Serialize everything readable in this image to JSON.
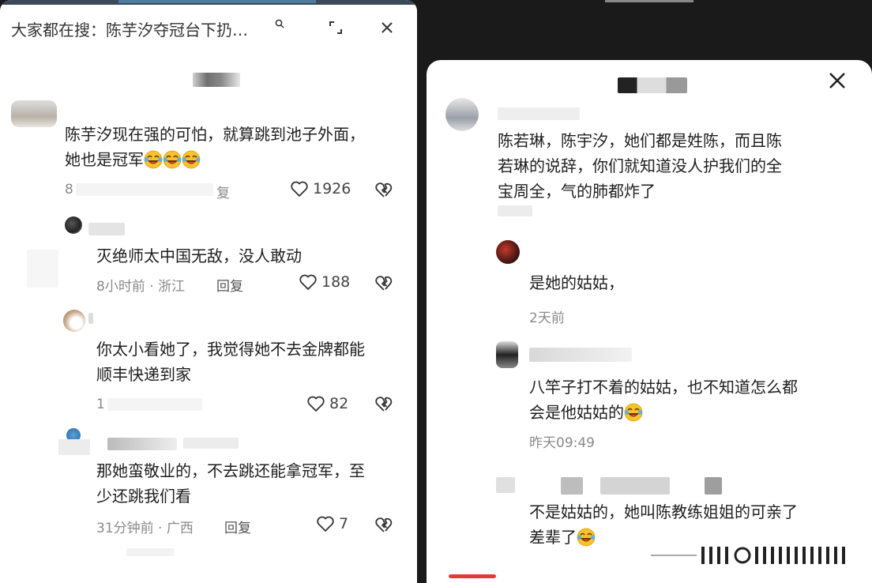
{
  "left_panel": {
    "search": {
      "prefix": "大家都在搜：",
      "query": "陈芋汐夺冠台下扔…"
    },
    "comments": [
      {
        "text_line1": "陈芋汐现在强的可怕，就算跳到池子外面，",
        "text_line2": "她也是冠军",
        "meta_partial": "8",
        "reply_partial": "复",
        "likes": "1926"
      },
      {
        "text": "灭绝师太中国无敌，没人敢动",
        "time": "8小时前",
        "location": "浙江",
        "reply": "回复",
        "likes": "188"
      },
      {
        "text_line1": "你太小看她了，我觉得她不去金牌都能",
        "text_line2": "顺丰快递到家",
        "meta_partial": "1",
        "likes": "82"
      },
      {
        "text_line1": "那她蛮敬业的，不去跳还能拿冠军，至",
        "text_line2": "少还跳我们看",
        "time": "31分钟前",
        "location": "广西",
        "reply": "回复",
        "likes": "7"
      }
    ]
  },
  "right_panel": {
    "comments": [
      {
        "text_line1": "陈若琳，陈宇汐，她们都是姓陈，而且陈",
        "text_line2": "若琳的说辞，你们就知道没人护我们的全",
        "text_line3": "宝周全，气的肺都炸了"
      },
      {
        "text": "是她的姑姑，",
        "time": "2天前"
      },
      {
        "text_line1": "八竿子打不着的姑姑，也不知道怎么都",
        "text_line2": "会是他姑姑的",
        "time": "昨天09:49"
      },
      {
        "text_line1": "不是姑姑的，她叫陈教练姐姐的可亲了",
        "text_line2": "差辈了"
      }
    ]
  },
  "colors": {
    "background": "#1a1a1a",
    "panel": "#ffffff",
    "meta_text": "#8a8a8a",
    "accent": "#e4393c"
  }
}
